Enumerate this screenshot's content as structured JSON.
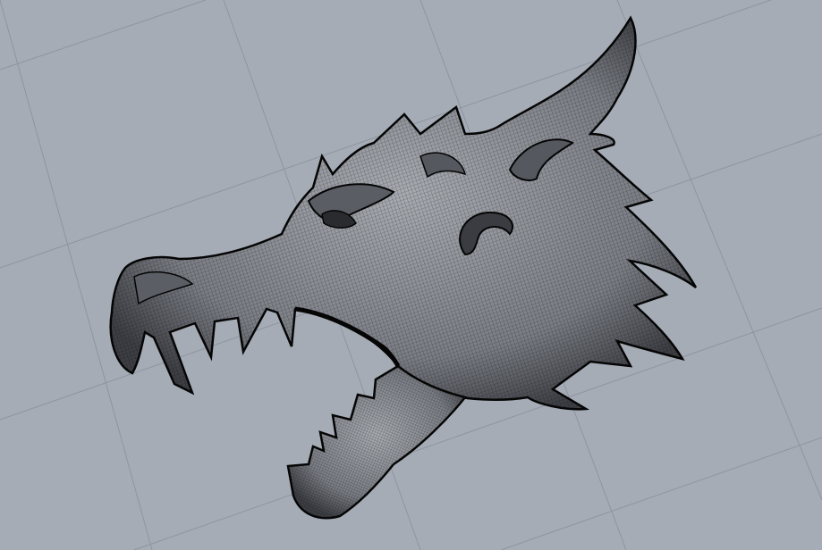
{
  "viewport": {
    "background_color": "#a5acb6",
    "grid_line_color": "#8f959e",
    "wire_color": "#0a0a0a",
    "mesh_fill_color": "#6e7178",
    "mesh_highlight_color": "#9a9da3",
    "display_mode": "wireframe",
    "grid_visible": true,
    "object": "dragon-head-mesh"
  }
}
